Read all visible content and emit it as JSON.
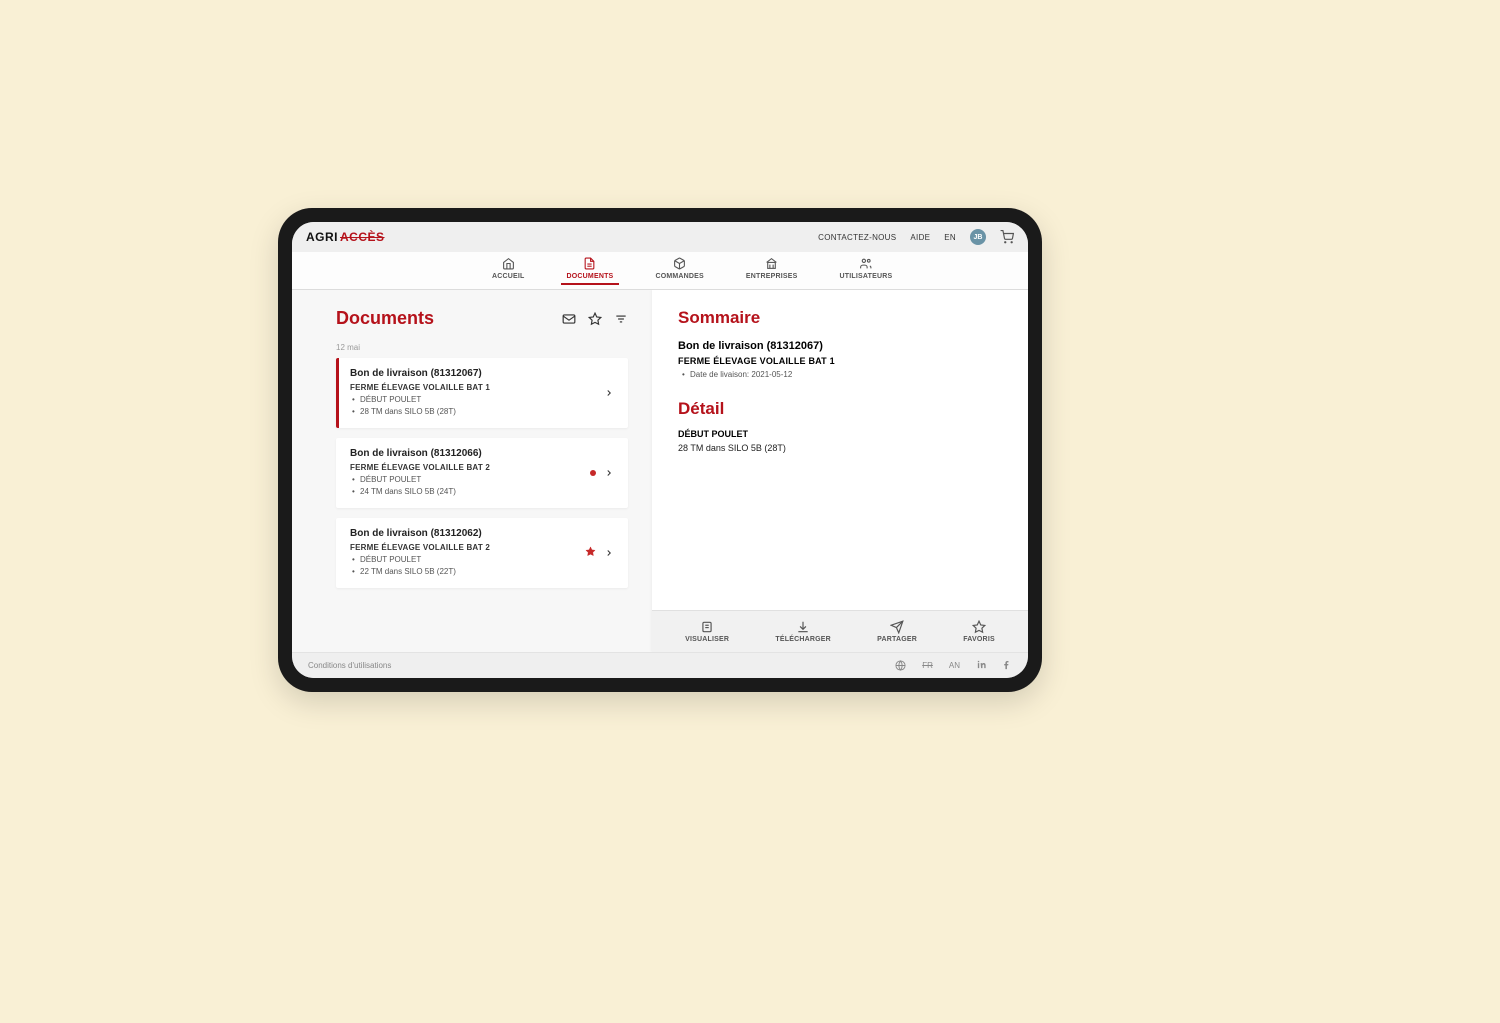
{
  "brand": {
    "first": "AGRI",
    "second": "ACCÈS"
  },
  "topbar": {
    "contact": "CONTACTEZ-NOUS",
    "help": "AIDE",
    "lang": "EN",
    "avatar": "JB"
  },
  "tabs": {
    "home": "ACCUEIL",
    "documents": "DOCUMENTS",
    "orders": "COMMANDES",
    "companies": "ENTREPRISES",
    "users": "UTILISATEURS"
  },
  "documents": {
    "title": "Documents",
    "date_group": "12 mai",
    "items": [
      {
        "title": "Bon de livraison (81312067)",
        "subtitle": "FERME ÉLEVAGE VOLAILLE BAT 1",
        "line1": "DÉBUT POULET",
        "line2": "28 TM dans SILO 5B (28T)",
        "selected": true,
        "indicator": "none"
      },
      {
        "title": "Bon de livraison (81312066)",
        "subtitle": "FERME ÉLEVAGE VOLAILLE BAT 2",
        "line1": "DÉBUT POULET",
        "line2": "24 TM dans SILO 5B (24T)",
        "selected": false,
        "indicator": "dot"
      },
      {
        "title": "Bon de livraison (81312062)",
        "subtitle": "FERME ÉLEVAGE VOLAILLE BAT 2",
        "line1": "DÉBUT POULET",
        "line2": "22 TM dans SILO 5B (22T)",
        "selected": false,
        "indicator": "star"
      }
    ]
  },
  "summary": {
    "title": "Sommaire",
    "doc_title": "Bon de livraison (81312067)",
    "company": "FERME ÉLEVAGE VOLAILLE BAT 1",
    "date": "Date de livaison: 2021-05-12"
  },
  "detail": {
    "title": "Détail",
    "product": "DÉBUT POULET",
    "qty": "28 TM dans SILO 5B (28T)"
  },
  "actions": {
    "view": "VISUALISER",
    "download": "TÉLÉCHARGER",
    "share": "PARTAGER",
    "favorite": "FAVORIS"
  },
  "footer": {
    "conditions": "Conditions d'utilisations",
    "lang_fr": "FR",
    "lang_en": "AN"
  }
}
